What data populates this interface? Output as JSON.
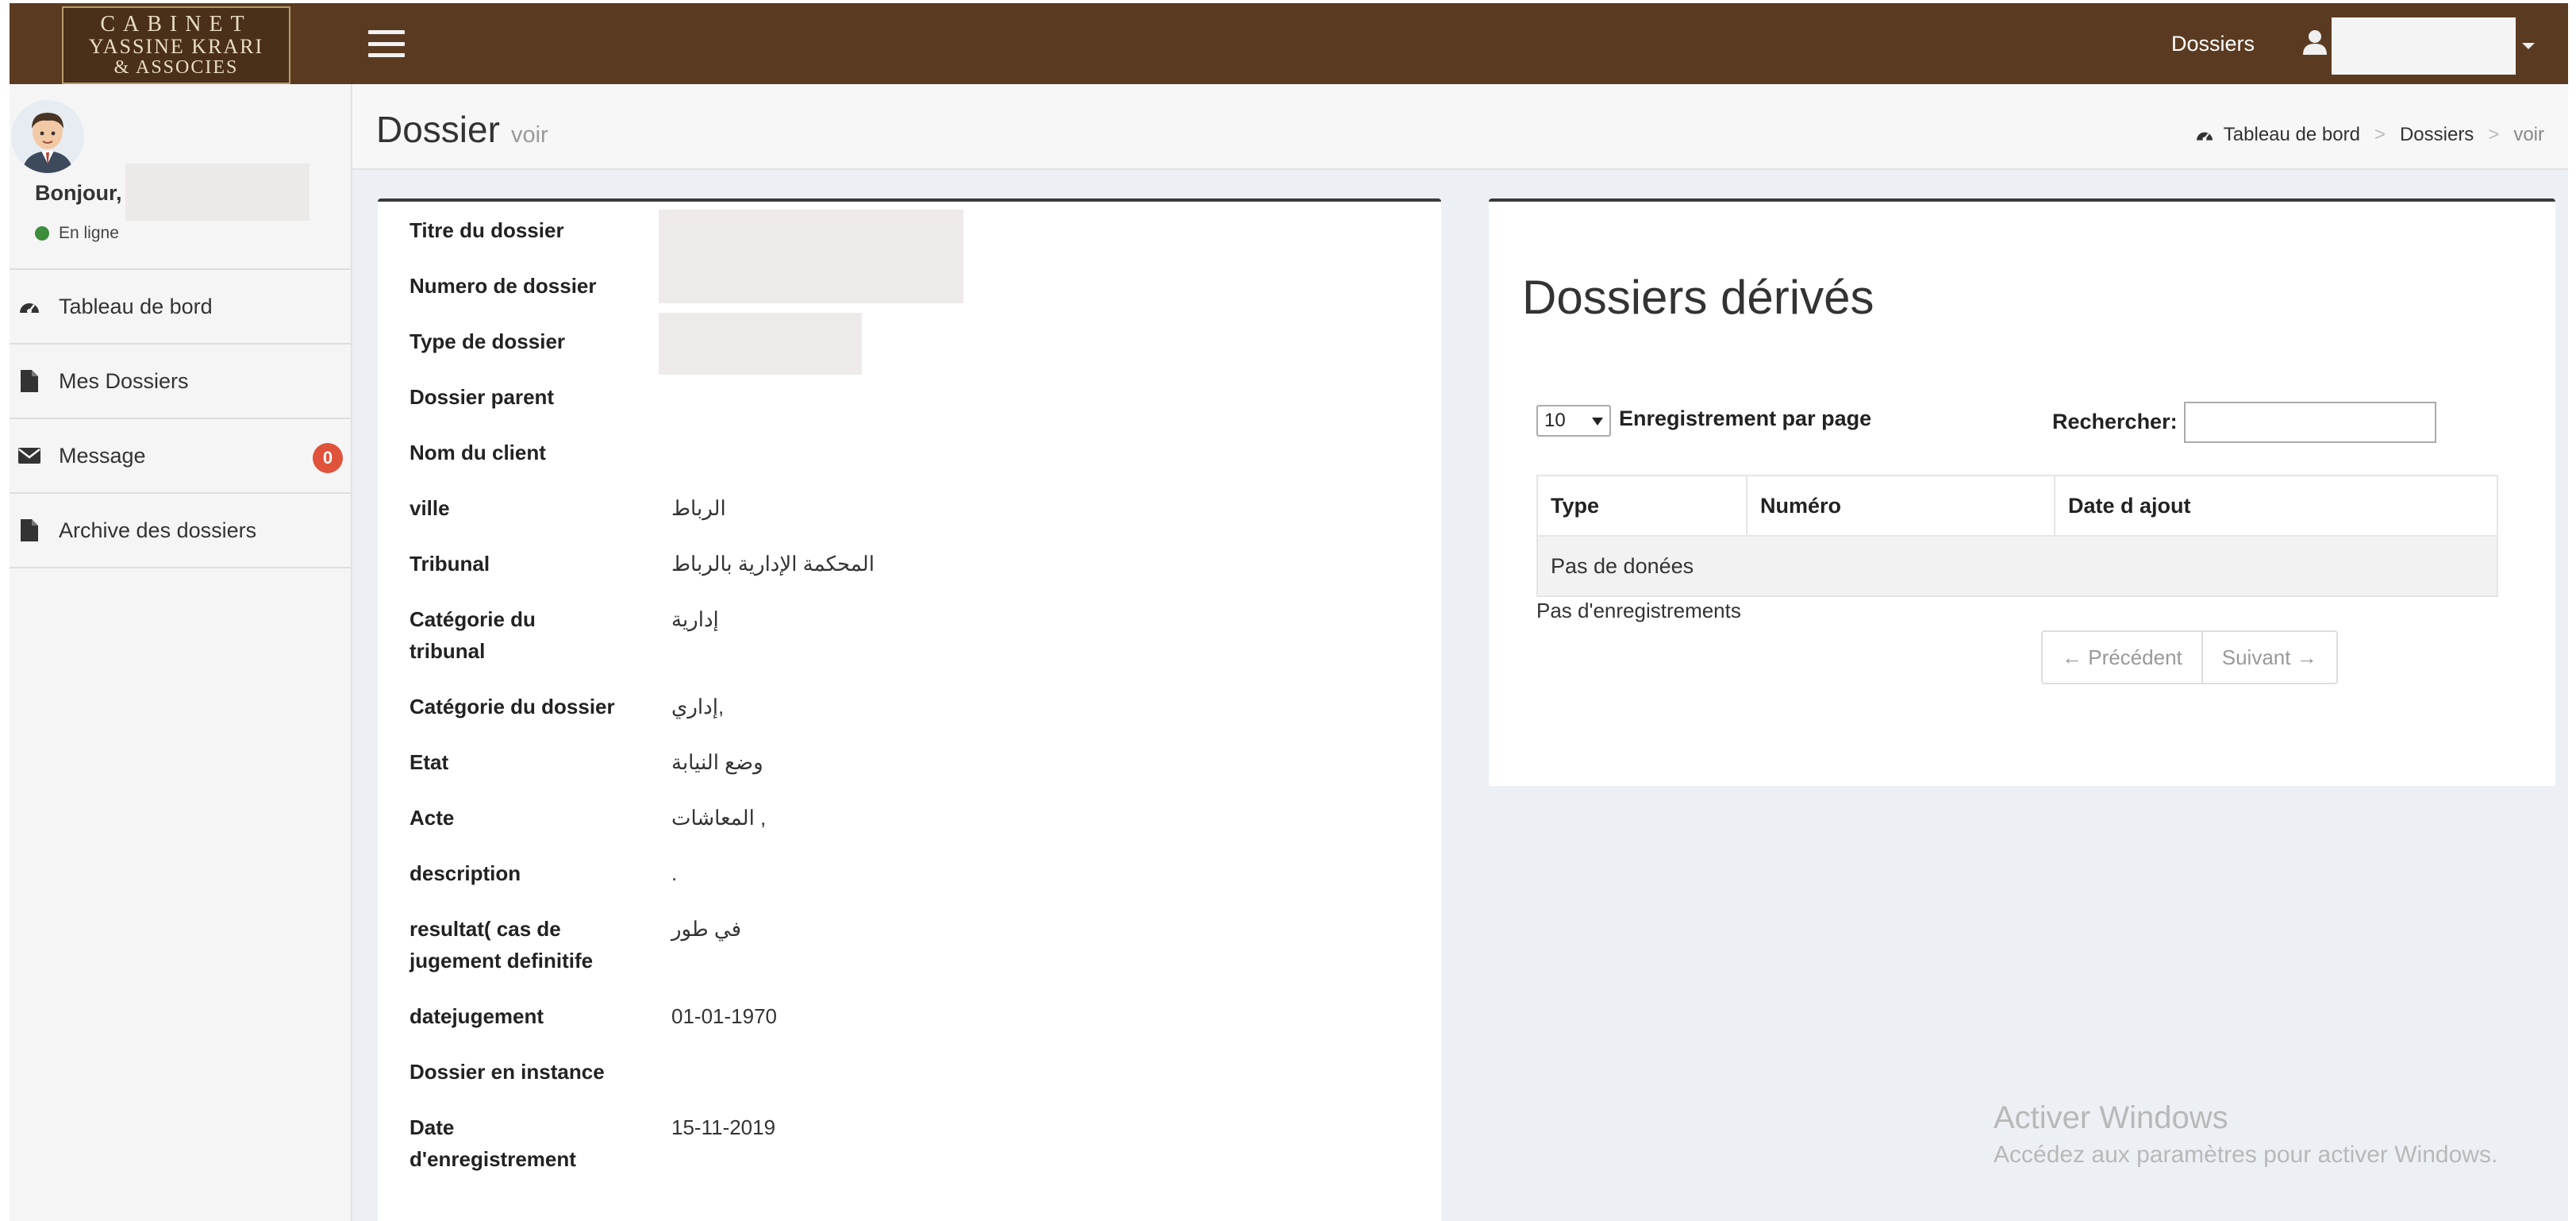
{
  "brand": {
    "line1": "CABINET",
    "line2": "YASSINE KRARI",
    "line3": "& ASSOCIES"
  },
  "topbar": {
    "nav_dossiers": "Dossiers",
    "menu_icon": "hamburger-icon",
    "user_icon": "user-icon"
  },
  "sidebar": {
    "greeting": "Bonjour,",
    "status": "En ligne",
    "status_color": "#3c8d3c",
    "items": [
      {
        "label": "Tableau de bord",
        "icon": "dashboard-icon"
      },
      {
        "label": "Mes Dossiers",
        "icon": "file-icon"
      },
      {
        "label": "Message",
        "icon": "envelope-icon",
        "badge": "0"
      },
      {
        "label": "Archive des dossiers",
        "icon": "file-icon"
      }
    ]
  },
  "page": {
    "title": "Dossier",
    "subtitle": "voir",
    "breadcrumb": [
      "Tableau de bord",
      "Dossiers",
      "voir"
    ]
  },
  "details": [
    {
      "label": "Titre du dossier",
      "value": ""
    },
    {
      "label": "Numero de dossier",
      "value": ""
    },
    {
      "label": "Type de dossier",
      "value": ""
    },
    {
      "label": "Dossier parent",
      "value": ""
    },
    {
      "label": "Nom du client",
      "value": ""
    },
    {
      "label": "ville",
      "value": "الرباط"
    },
    {
      "label": "Tribunal",
      "value": "المحكمة الإدارية بالرباط"
    },
    {
      "label": "Catégorie du tribunal",
      "value": "إدارية"
    },
    {
      "label": "Catégorie du dossier",
      "value": "إداري,"
    },
    {
      "label": "Etat",
      "value": "وضع النيابة"
    },
    {
      "label": "Acte",
      "value": "المعاشات ,"
    },
    {
      "label": "description",
      "value": "."
    },
    {
      "label": "resultat( cas de jugement definitife",
      "value": "في طور"
    },
    {
      "label": "datejugement",
      "value": "01-01-1970"
    },
    {
      "label": "Dossier en instance",
      "value": ""
    },
    {
      "label": "Date d'enregistrement",
      "value": "15-11-2019"
    }
  ],
  "derived": {
    "title": "Dossiers dérivés",
    "page_length": "10",
    "page_length_label": "Enregistrement par page",
    "search_label": "Rechercher:",
    "columns": [
      "Type",
      "Numéro",
      "Date d ajout"
    ],
    "empty_row": "Pas de donées",
    "info": "Pas d'enregistrements",
    "prev": "← Précédent",
    "next": "Suivant →"
  },
  "watermark": {
    "line1": "Activer Windows",
    "line2": "Accédez aux paramètres pour activer Windows."
  },
  "colors": {
    "header": "#5a3b22",
    "badge": "#e0533b",
    "card_border": "#3a3a3a"
  }
}
